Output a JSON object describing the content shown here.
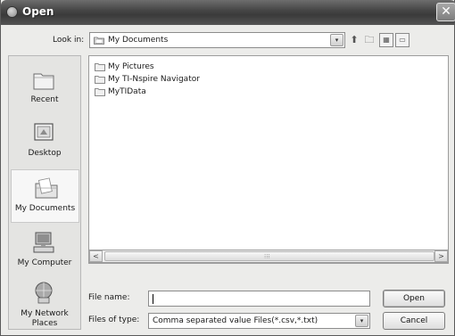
{
  "window": {
    "title": "Open",
    "close_glyph": "✕"
  },
  "toolbar": {
    "look_in_label": "Look in:",
    "look_in_value": "My Documents",
    "dropdown_glyph": "▾",
    "up_glyph": "⬆",
    "new_folder_glyph": "🗀",
    "views_glyph": "▦",
    "menu_glyph": "▭"
  },
  "places": [
    {
      "label": "Recent",
      "icon": "recent-icon"
    },
    {
      "label": "Desktop",
      "icon": "desktop-icon"
    },
    {
      "label": "My Documents",
      "icon": "my-documents-icon",
      "selected": true
    },
    {
      "label": "My Computer",
      "icon": "my-computer-icon"
    },
    {
      "label": "My Network Places",
      "icon": "network-places-icon"
    }
  ],
  "files": [
    {
      "name": "My Pictures"
    },
    {
      "name": "My TI-Nspire Navigator"
    },
    {
      "name": "MyTIData"
    }
  ],
  "scrollbar": {
    "left_glyph": "<",
    "right_glyph": ">",
    "grip_glyph": "⁝⁝⁝"
  },
  "form": {
    "file_name_label": "File name:",
    "file_name_value": "",
    "files_of_type_label": "Files of type:",
    "files_of_type_value": "Comma separated value Files(*.csv,*.txt)"
  },
  "buttons": {
    "open": "Open",
    "cancel": "Cancel"
  },
  "colors": {
    "titlebar": "#474747",
    "dialog_bg": "#ececea",
    "list_bg": "#ffffff"
  }
}
